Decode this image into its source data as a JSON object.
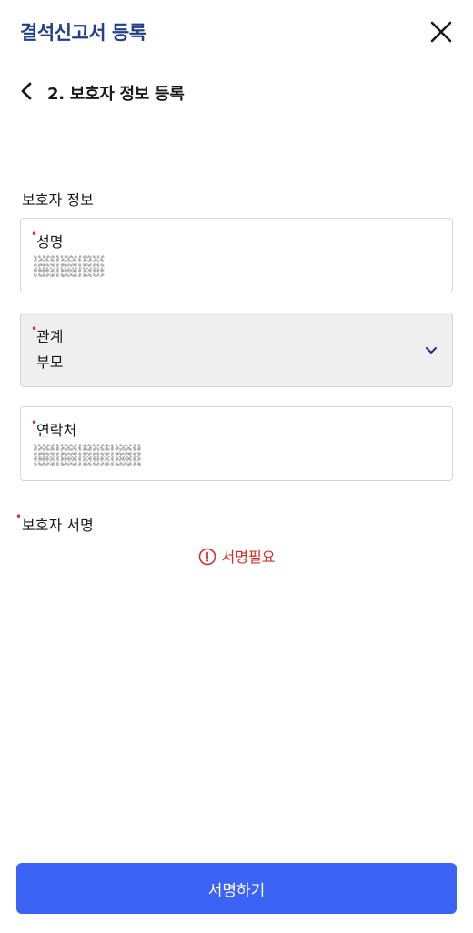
{
  "header": {
    "title": "결석신고서 등록",
    "close_icon": "close-icon"
  },
  "step": {
    "back_icon": "chevron-left-icon",
    "title": "2. 보호자 정보 등록"
  },
  "section": {
    "title": "보호자 정보"
  },
  "fields": {
    "name": {
      "label": "성명",
      "required_mark": "•",
      "value_masked": true
    },
    "relation": {
      "label": "관계",
      "required_mark": "•",
      "value": "부모",
      "dropdown_icon": "chevron-down-icon"
    },
    "phone": {
      "label": "연락처",
      "required_mark": "•",
      "value_masked": true
    }
  },
  "signature": {
    "label": "보호자 서명",
    "required_mark": "•",
    "status_text": "서명필요",
    "status_icon": "alert-circle-icon"
  },
  "actions": {
    "sign_label": "서명하기"
  },
  "colors": {
    "title_blue": "#1f3f86",
    "required_red": "#d0312d",
    "button_blue": "#3b63f5",
    "disabled_bg": "#efefef"
  }
}
